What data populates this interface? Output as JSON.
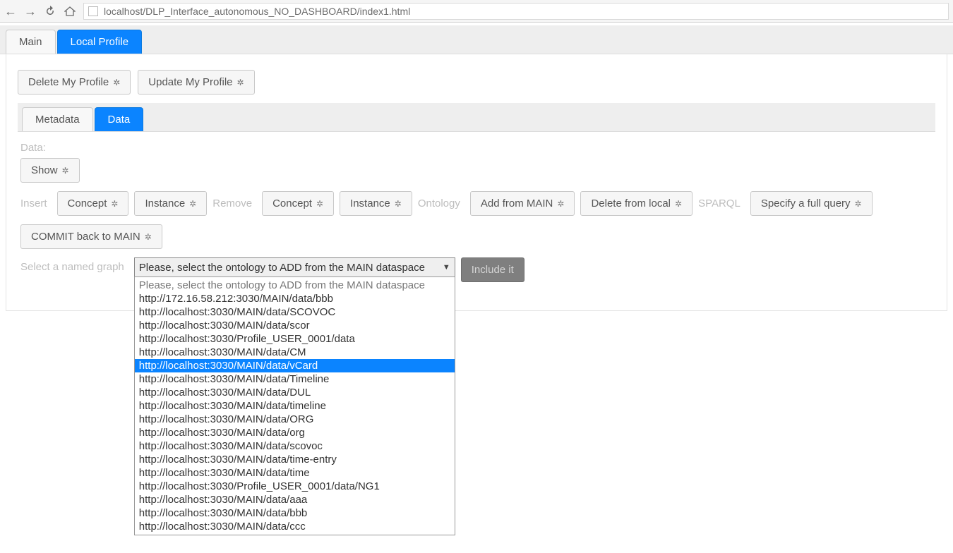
{
  "browser": {
    "url": "localhost/DLP_Interface_autonomous_NO_DASHBOARD/index1.html"
  },
  "top_tabs": {
    "main": "Main",
    "local_profile": "Local Profile"
  },
  "profile_buttons": {
    "delete": "Delete My Profile",
    "update": "Update My Profile"
  },
  "sub_tabs": {
    "metadata": "Metadata",
    "data": "Data"
  },
  "data_section": {
    "label": "Data:",
    "show": "Show"
  },
  "action_row": {
    "insert_label": "Insert",
    "concept": "Concept",
    "instance": "Instance",
    "remove_label": "Remove",
    "concept2": "Concept",
    "instance2": "Instance",
    "ontology_label": "Ontology",
    "add_from_main": "Add from MAIN",
    "delete_from_local": "Delete from local",
    "sparql_label": "SPARQL",
    "specify_query": "Specify a full query",
    "commit": "COMMIT back to MAIN"
  },
  "graph_select": {
    "label": "Select a named graph",
    "selected": "Please, select the ontology to ADD from the MAIN dataspace",
    "include": "Include it",
    "highlight_index": 6,
    "options": [
      "Please, select the ontology to ADD from the MAIN dataspace",
      "http://172.16.58.212:3030/MAIN/data/bbb",
      "http://localhost:3030/MAIN/data/SCOVOC",
      "http://localhost:3030/MAIN/data/scor",
      "http://localhost:3030/Profile_USER_0001/data",
      "http://localhost:3030/MAIN/data/CM",
      "http://localhost:3030/MAIN/data/vCard",
      "http://localhost:3030/MAIN/data/Timeline",
      "http://localhost:3030/MAIN/data/DUL",
      "http://localhost:3030/MAIN/data/timeline",
      "http://localhost:3030/MAIN/data/ORG",
      "http://localhost:3030/MAIN/data/org",
      "http://localhost:3030/MAIN/data/scovoc",
      "http://localhost:3030/MAIN/data/time-entry",
      "http://localhost:3030/MAIN/data/time",
      "http://localhost:3030/Profile_USER_0001/data/NG1",
      "http://localhost:3030/MAIN/data/aaa",
      "http://localhost:3030/MAIN/data/bbb",
      "http://localhost:3030/MAIN/data/ccc"
    ]
  }
}
